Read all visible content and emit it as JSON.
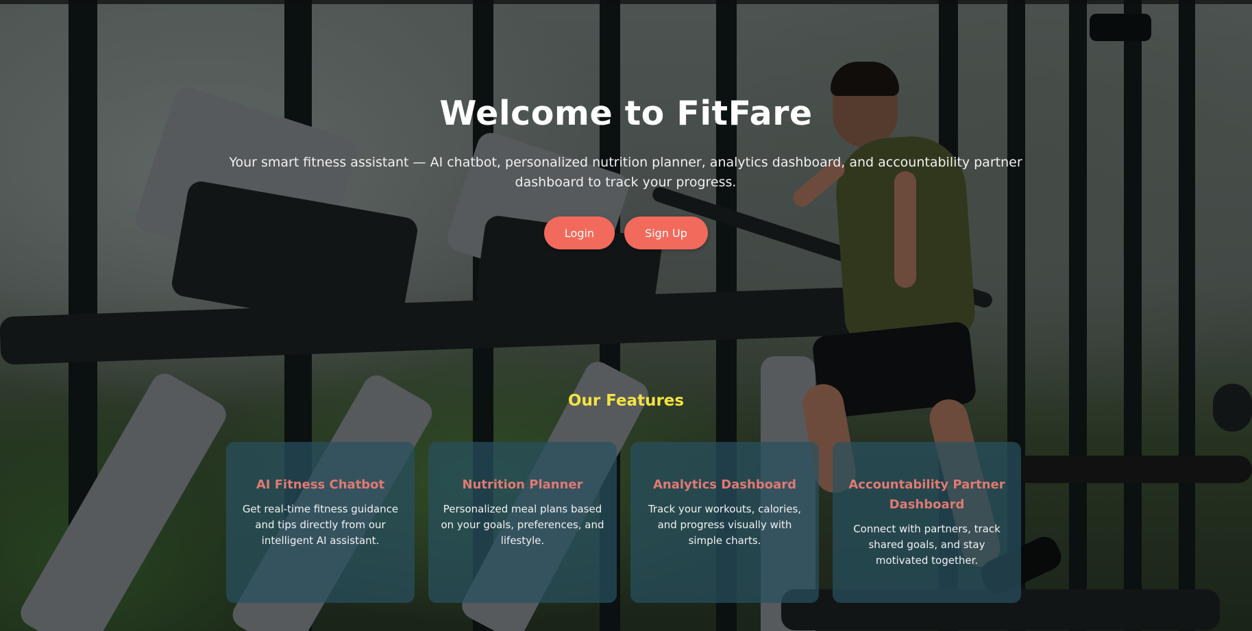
{
  "hero": {
    "title": "Welcome to FitFare",
    "subtitle": "Your smart fitness assistant — AI chatbot, personalized nutrition planner, analytics dashboard, and accountability partner dashboard to track your progress.",
    "login_label": "Login",
    "signup_label": "Sign Up"
  },
  "features": {
    "heading": "Our Features",
    "cards": [
      {
        "title": "AI Fitness Chatbot",
        "description": "Get real-time fitness guidance and tips directly from our intelligent AI assistant."
      },
      {
        "title": "Nutrition Planner",
        "description": "Personalized meal plans based on your goals, preferences, and lifestyle."
      },
      {
        "title": "Analytics Dashboard",
        "description": "Track your workouts, calories, and progress visually with simple charts."
      },
      {
        "title": "Accountability Partner Dashboard",
        "description": "Connect with partners, track shared goals, and stay motivated together."
      }
    ]
  },
  "colors": {
    "button": "#f26a5b",
    "features_heading": "#f4e442",
    "card_title": "#e07a72",
    "card_background": "rgba(40,80,95,0.72)"
  },
  "background": {
    "image": "gym-treadmill-runner-photo"
  }
}
